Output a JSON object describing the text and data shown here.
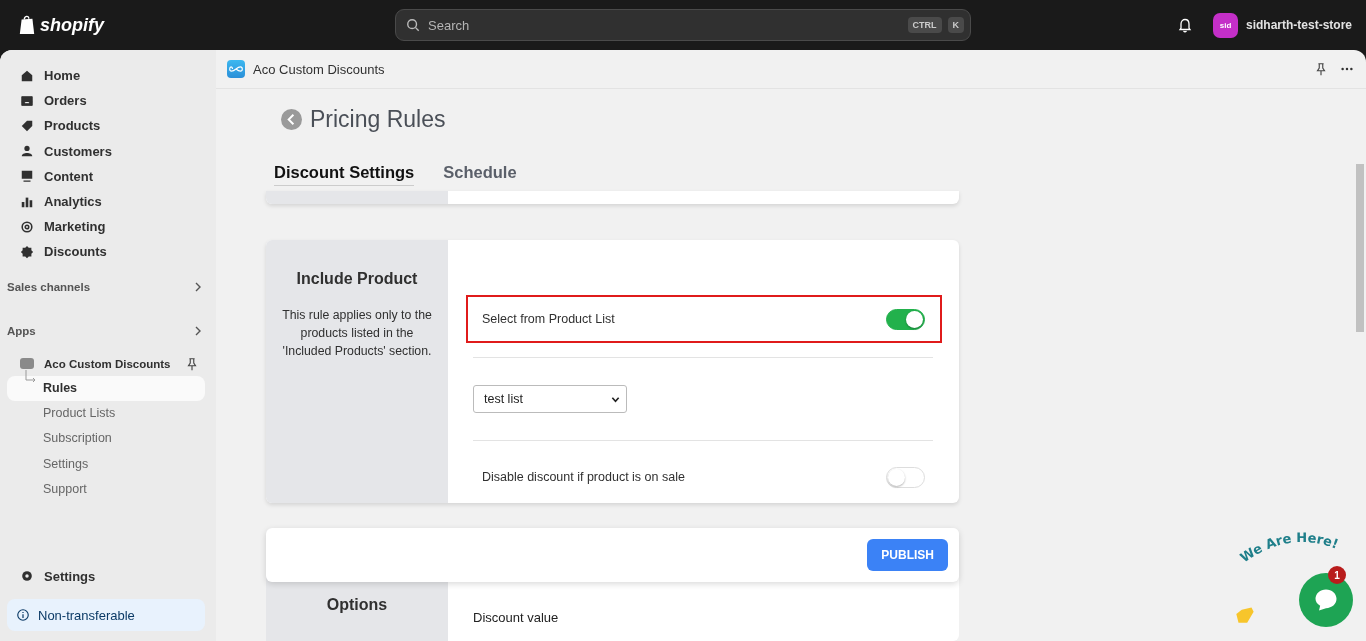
{
  "topbar": {
    "logo": "shopify",
    "search": {
      "placeholder": "Search",
      "keys": [
        "CTRL",
        "K"
      ]
    },
    "store": {
      "avatar": "sid",
      "name": "sidharth-test-store"
    }
  },
  "sidebar": {
    "items": [
      {
        "label": "Home",
        "selected": false
      },
      {
        "label": "Orders",
        "selected": false
      },
      {
        "label": "Products",
        "selected": false
      },
      {
        "label": "Customers",
        "selected": false
      },
      {
        "label": "Content",
        "selected": false
      },
      {
        "label": "Analytics",
        "selected": false
      },
      {
        "label": "Marketing",
        "selected": false
      },
      {
        "label": "Discounts",
        "selected": false
      }
    ],
    "sections": [
      {
        "label": "Sales channels"
      },
      {
        "label": "Apps"
      }
    ],
    "app": {
      "label": "Aco Custom Discounts",
      "children": [
        {
          "label": "Rules",
          "selected": true
        },
        {
          "label": "Product Lists",
          "selected": false
        },
        {
          "label": "Subscription",
          "selected": false
        },
        {
          "label": "Settings",
          "selected": false
        },
        {
          "label": "Support",
          "selected": false
        }
      ]
    },
    "settings": "Settings",
    "notice": "Non-transferable"
  },
  "app_header": {
    "title": "Aco Custom Discounts"
  },
  "page": {
    "title": "Pricing Rules",
    "tabs": [
      {
        "label": "Discount Settings",
        "selected": true
      },
      {
        "label": "Schedule",
        "selected": false
      }
    ],
    "include_card": {
      "title": "Include Product",
      "description": "This rule applies only to the products listed in the 'Included Products' section.",
      "settings": [
        {
          "kind": "toggle",
          "label": "Select from Product List",
          "on": true,
          "highlighted": true
        },
        {
          "kind": "select",
          "value": "test list"
        },
        {
          "kind": "toggle",
          "label": "Disable discount if product is on sale",
          "on": false,
          "highlighted": false
        }
      ]
    },
    "options_card": {
      "title": "Options",
      "field_label": "Discount value"
    },
    "publish_button": "PUBLISH"
  },
  "chat_widget": {
    "caption": "We Are Here!",
    "badge": "1"
  }
}
